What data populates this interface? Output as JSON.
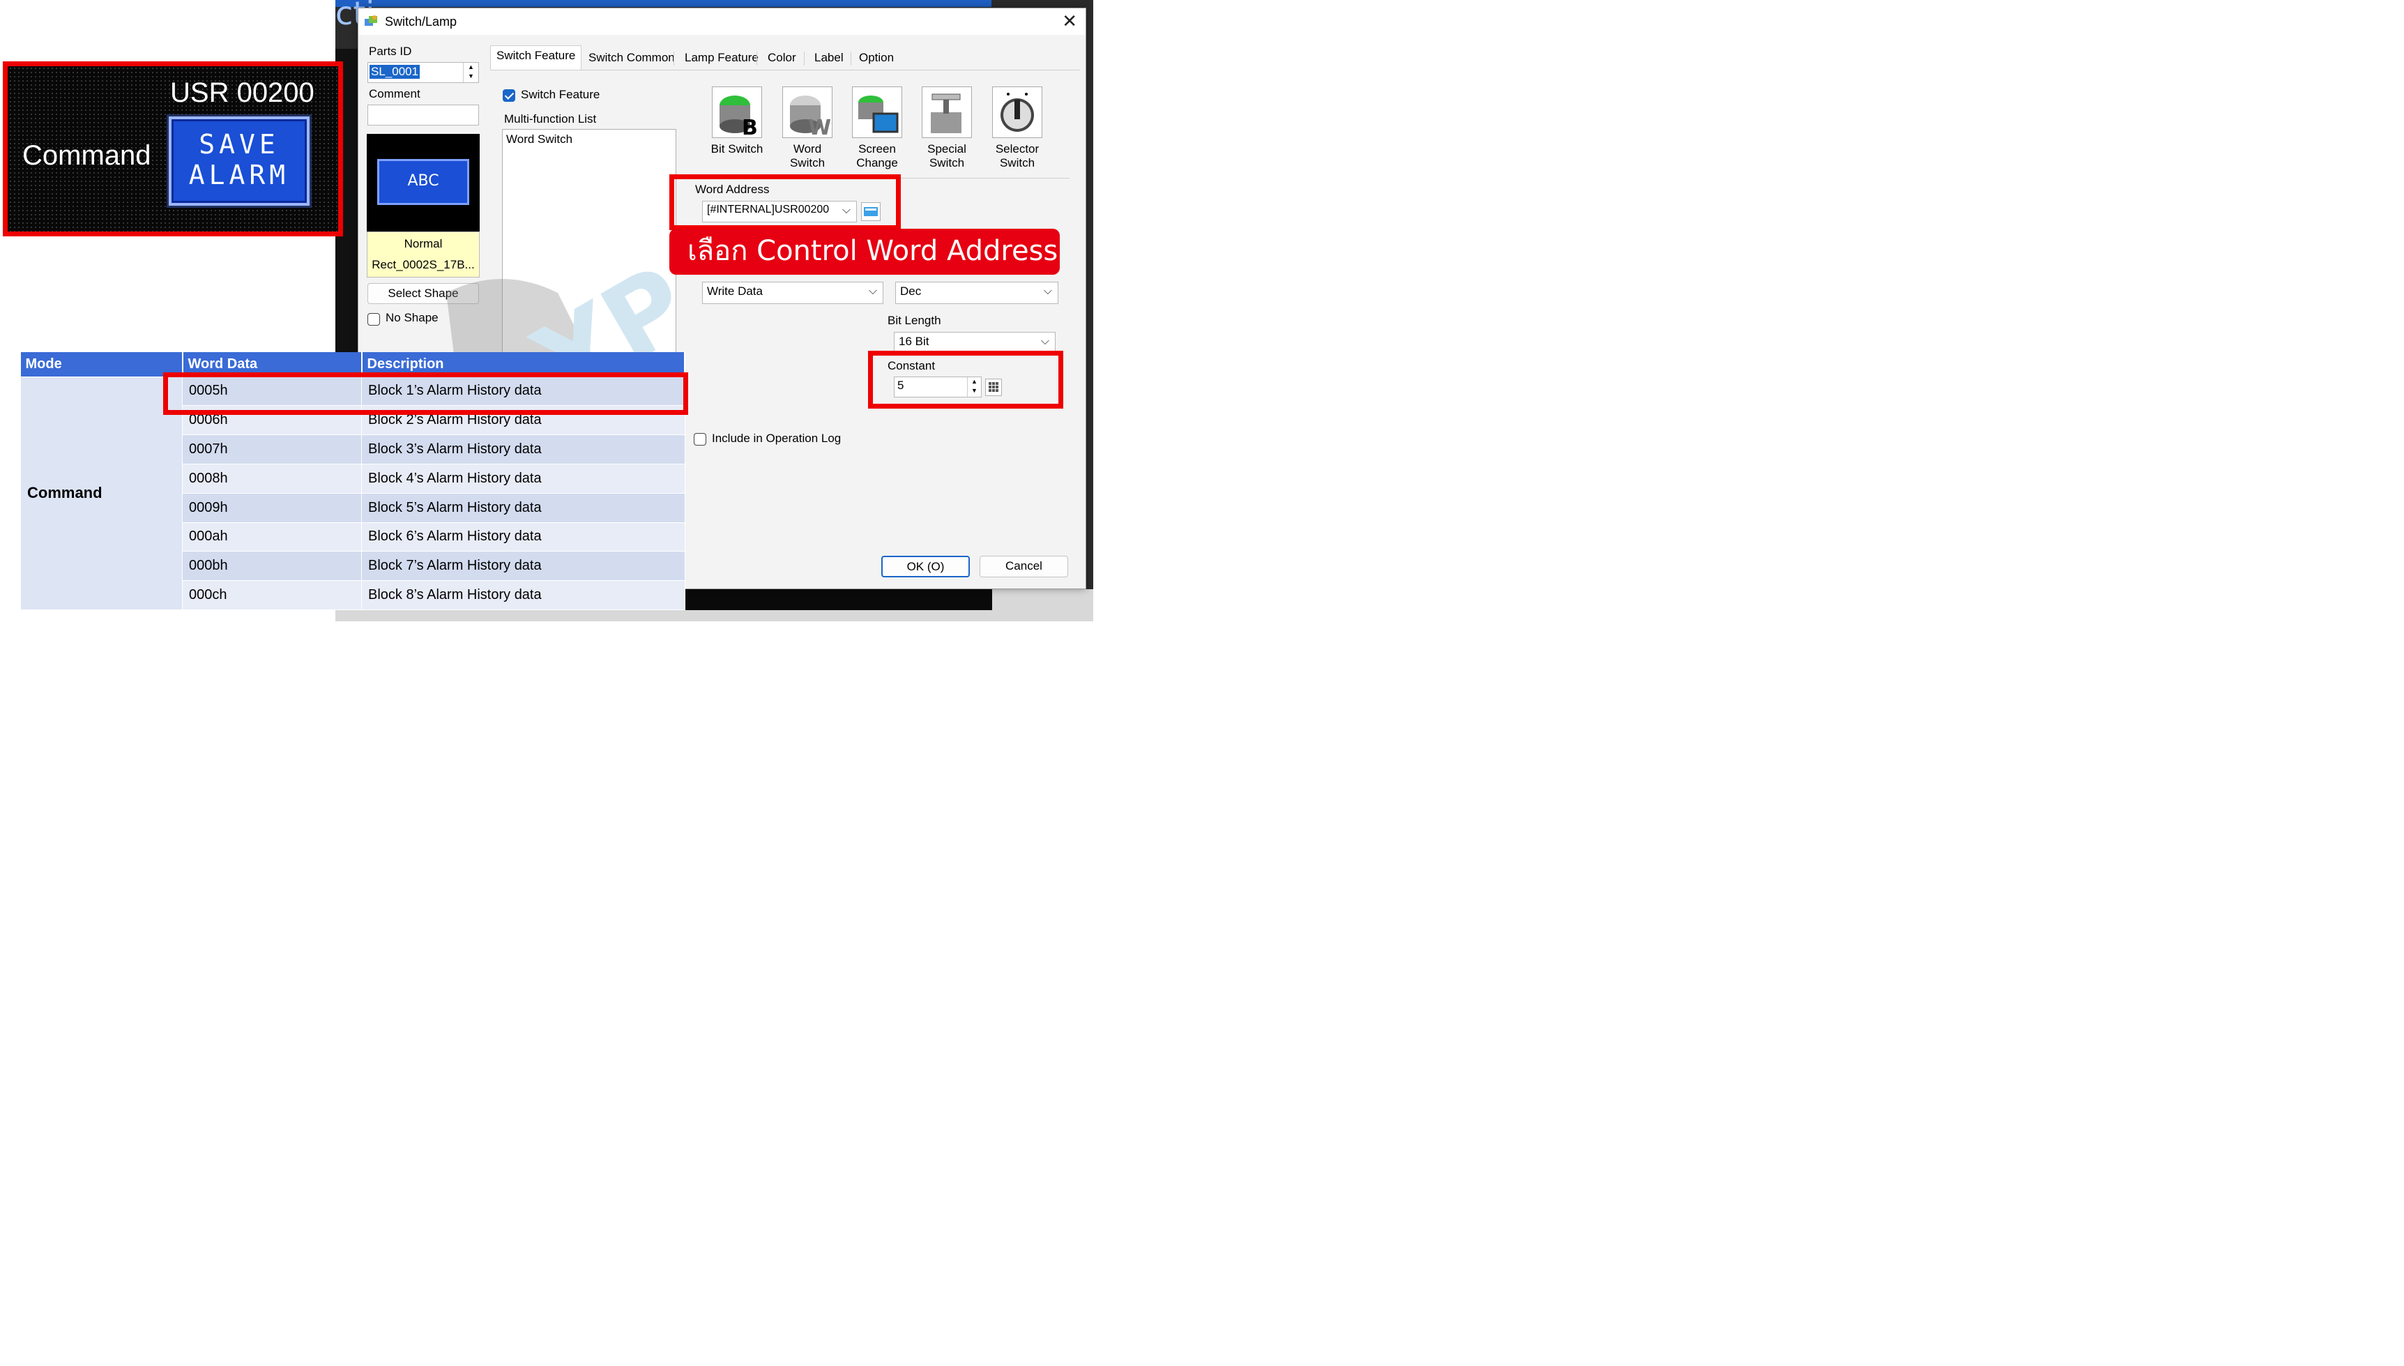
{
  "background_window": {
    "title_fragment": "cti"
  },
  "dialog": {
    "title": "Switch/Lamp",
    "parts_id_label": "Parts ID",
    "parts_id_value": "SL_0001",
    "comment_label": "Comment",
    "comment_value": "",
    "preview_text": "ABC",
    "preview_state": "Normal",
    "preview_shape": "Rect_0002S_17B...",
    "select_shape_button": "Select Shape",
    "no_shape_label": "No Shape",
    "tabs": [
      "Switch Feature",
      "Switch Common",
      "Lamp Feature",
      "Color",
      "Label",
      "Option"
    ],
    "switch_feature_checkbox": "Switch Feature",
    "multi_function_label": "Multi-function List",
    "multi_function_items": [
      "Word Switch"
    ],
    "switch_types": [
      {
        "line1": "Bit Switch",
        "line2": "",
        "icon": "bit-switch-icon"
      },
      {
        "line1": "Word",
        "line2": "Switch",
        "icon": "word-switch-icon"
      },
      {
        "line1": "Screen",
        "line2": "Change",
        "icon": "screen-change-icon"
      },
      {
        "line1": "Special",
        "line2": "Switch",
        "icon": "special-switch-icon"
      },
      {
        "line1": "Selector",
        "line2": "Switch",
        "icon": "selector-switch-icon"
      }
    ],
    "word_address_label": "Word Address",
    "word_address_value": "[#INTERNAL]USR00200",
    "operation_value": "Write Data",
    "data_type_value": "Dec",
    "bit_length_label": "Bit Length",
    "bit_length_value": "16 Bit",
    "constant_label": "Constant",
    "constant_value": "5",
    "operation_log_label": "Include in Operation Log",
    "ok_button": "OK (O)",
    "cancel_button": "Cancel"
  },
  "callout_text": "เลือก Control Word Address",
  "hmi": {
    "address_text": "USR 00200",
    "command_text": "Command",
    "button_line1": "SAVE",
    "button_line2": "ALARM"
  },
  "table": {
    "headers": [
      "Mode",
      "Word Data",
      "Description"
    ],
    "mode": "Command",
    "rows": [
      {
        "word": "0005h",
        "desc": "Block 1’s Alarm History data"
      },
      {
        "word": "0006h",
        "desc": "Block 2’s Alarm History data"
      },
      {
        "word": "0007h",
        "desc": "Block 3’s Alarm History data"
      },
      {
        "word": "0008h",
        "desc": "Block 4’s Alarm History data"
      },
      {
        "word": "0009h",
        "desc": "Block 5’s Alarm History data"
      },
      {
        "word": "000ah",
        "desc": "Block 6’s Alarm History data"
      },
      {
        "word": "000bh",
        "desc": "Block 7’s Alarm History data"
      },
      {
        "word": "000ch",
        "desc": "Block 8’s Alarm History data"
      }
    ]
  },
  "colors": {
    "highlight_red": "#ee0000",
    "callout_red": "#e60012",
    "table_header_blue": "#3a6bd6",
    "hmi_button_blue": "#1a4fd6"
  }
}
